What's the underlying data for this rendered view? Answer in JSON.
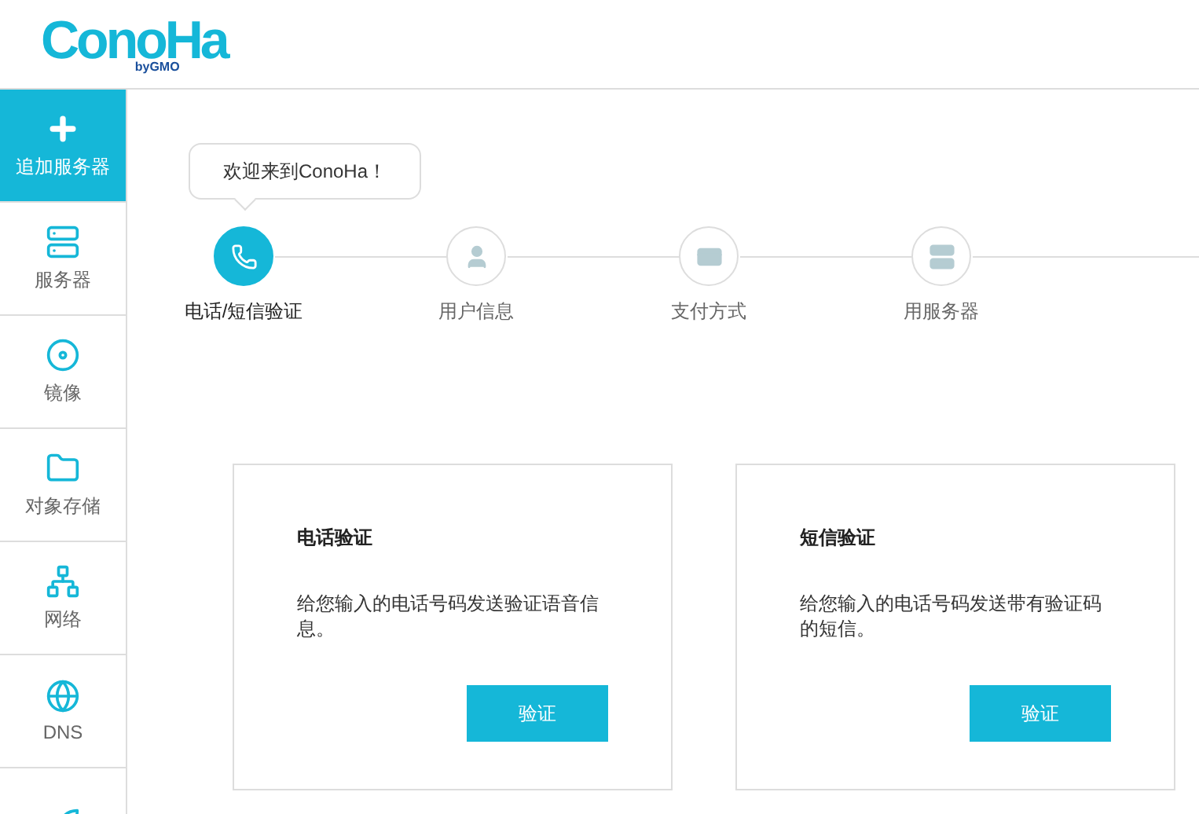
{
  "logo": {
    "wordmark": "ConoHa",
    "byline": "byGMO"
  },
  "sidebar": {
    "items": [
      {
        "kind": "plus",
        "label": "追加服务器",
        "selected": true
      },
      {
        "kind": "server",
        "label": "服务器",
        "selected": false
      },
      {
        "kind": "disc",
        "label": "镜像",
        "selected": false
      },
      {
        "kind": "folder",
        "label": "对象存储",
        "selected": false
      },
      {
        "kind": "network",
        "label": "网络",
        "selected": false
      },
      {
        "kind": "globe",
        "label": "DNS",
        "selected": false
      },
      {
        "kind": "rocket",
        "selected": false
      }
    ]
  },
  "welcome_bubble": "欢迎来到ConoHa！",
  "steps": [
    {
      "kind": "phone",
      "label": "电话/短信验证",
      "active": true
    },
    {
      "kind": "user",
      "label": "用户信息",
      "active": false
    },
    {
      "kind": "card",
      "label": "支付方式",
      "active": false
    },
    {
      "kind": "server",
      "label": "用服务器",
      "active": false
    }
  ],
  "cards": [
    {
      "title": "电话验证",
      "text": "给您输入的电话号码发送验证语音信息。",
      "button": "验证"
    },
    {
      "title": "短信验证",
      "text": "给您输入的电话号码发送带有验证码的短信。",
      "button": "验证"
    }
  ]
}
